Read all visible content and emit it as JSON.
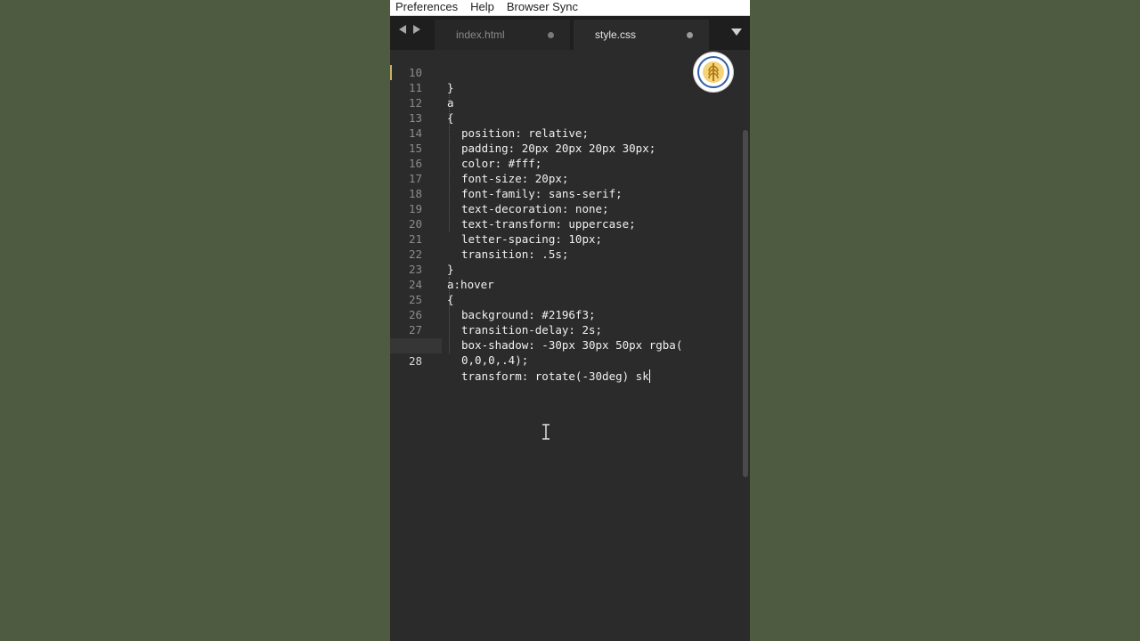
{
  "menubar": {
    "items": [
      "Preferences",
      "Help",
      "Browser Sync"
    ]
  },
  "tabs": [
    {
      "label": "index.html",
      "active": false
    },
    {
      "label": "style.css",
      "active": true
    }
  ],
  "editor": {
    "lines": [
      {
        "n": "10",
        "text": "}"
      },
      {
        "n": "11",
        "text": "a"
      },
      {
        "n": "12",
        "text": "{"
      },
      {
        "n": "13",
        "text": "position: relative;"
      },
      {
        "n": "14",
        "text": "padding: 20px 20px 20px 30px;"
      },
      {
        "n": "15",
        "text": "color: #fff;"
      },
      {
        "n": "16",
        "text": "font-size: 20px;"
      },
      {
        "n": "17",
        "text": "font-family: sans-serif;"
      },
      {
        "n": "18",
        "text": "text-decoration: none;"
      },
      {
        "n": "19",
        "text": "text-transform: uppercase;"
      },
      {
        "n": "20",
        "text": "letter-spacing: 10px;"
      },
      {
        "n": "21",
        "text": "transition: .5s;"
      },
      {
        "n": "22",
        "text": "}"
      },
      {
        "n": "23",
        "text": "a:hover"
      },
      {
        "n": "24",
        "text": "{"
      },
      {
        "n": "25",
        "text": "background: #2196f3;"
      },
      {
        "n": "26",
        "text": "transition-delay: 2s;"
      },
      {
        "n": "27",
        "text": "box-shadow: -30px 30px 50px rgba("
      },
      {
        "n": "",
        "text": "0,0,0,.4);"
      },
      {
        "n": "28",
        "text": "transform: rotate(-30deg) sk"
      }
    ]
  },
  "colors": {
    "desktop_background": "#4f5b40",
    "editor_background": "#2b2b2b",
    "modified_marker": "#c8b25a"
  },
  "icons": {
    "nav_back": "chevron-left-icon",
    "nav_forward": "chevron-right-icon",
    "tab_dropdown": "caret-down-icon",
    "logo": "wheat-emblem-icon",
    "mouse_cursor": "text-cursor-icon"
  }
}
